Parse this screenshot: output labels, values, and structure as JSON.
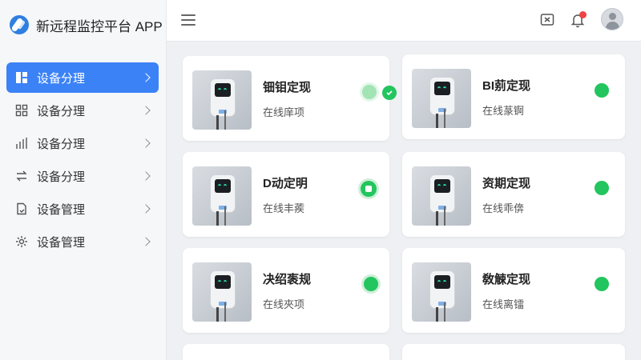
{
  "app": {
    "title": "新远程监控平台 APP"
  },
  "sidebar": {
    "items": [
      {
        "label": "设备分理",
        "icon": "dashboard-icon",
        "active": true
      },
      {
        "label": "设备分理",
        "icon": "grid-icon",
        "active": false
      },
      {
        "label": "设备分理",
        "icon": "bar-chart-icon",
        "active": false
      },
      {
        "label": "设备分理",
        "icon": "swap-icon",
        "active": false
      },
      {
        "label": "设备管理",
        "icon": "document-icon",
        "active": false
      },
      {
        "label": "设备管理",
        "icon": "gear-icon",
        "active": false
      }
    ]
  },
  "header": {
    "icons": [
      "menu-icon",
      "screen-share-icon",
      "bell-icon",
      "avatar"
    ]
  },
  "devices": [
    {
      "title": "钿钼定现",
      "status": "在线庠项"
    },
    {
      "title": "BI莂定现",
      "status": "在线蒃锕"
    },
    {
      "title": "D动定明",
      "status": "在线丰蒺"
    },
    {
      "title": "资期定现",
      "status": "在线乖倴"
    },
    {
      "title": "决绍袠规",
      "status": "在线夾项"
    },
    {
      "title": "敎觫定现",
      "status": "在线离镭"
    }
  ],
  "colors": {
    "accent": "#3b82f6",
    "online": "#22c55e",
    "alert": "#ef4444"
  }
}
